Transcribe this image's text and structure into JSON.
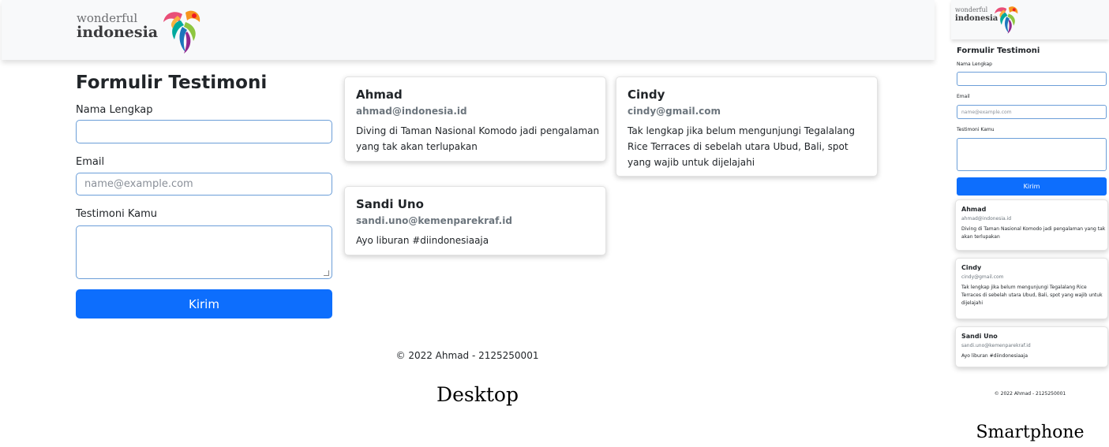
{
  "brand": {
    "logo_small": "wonderful",
    "logo_main": "indonesia"
  },
  "form": {
    "title": "Formulir Testimoni",
    "name_label": "Nama Lengkap",
    "name_value": "",
    "email_label": "Email",
    "email_placeholder": "name@example.com",
    "testimoni_label": "Testimoni Kamu",
    "testimoni_value": "",
    "submit_label": "Kirim"
  },
  "testimonials": [
    {
      "name": "Ahmad",
      "email": "ahmad@indonesia.id",
      "text": "Diving di Taman Nasional Komodo jadi pengalaman yang tak akan terlupakan"
    },
    {
      "name": "Cindy",
      "email": "cindy@gmail.com",
      "text": "Tak lengkap jika belum mengunjungi Tegalalang Rice Terraces di sebelah utara Ubud, Bali, spot yang wajib untuk dijelajahi"
    },
    {
      "name": "Sandi Uno",
      "email": "sandi.uno@kemenparekraf.id",
      "text": "Ayo liburan #diindonesiaaja"
    }
  ],
  "footer": {
    "text": "© 2022 Ahmad - 2125250001"
  },
  "captions": {
    "desktop": "Desktop",
    "smartphone": "Smartphone"
  },
  "colors": {
    "primary": "#0d6efd",
    "navbar_bg": "#f8f9fa",
    "input_border": "#6b9ed8",
    "muted": "#6c757d"
  }
}
